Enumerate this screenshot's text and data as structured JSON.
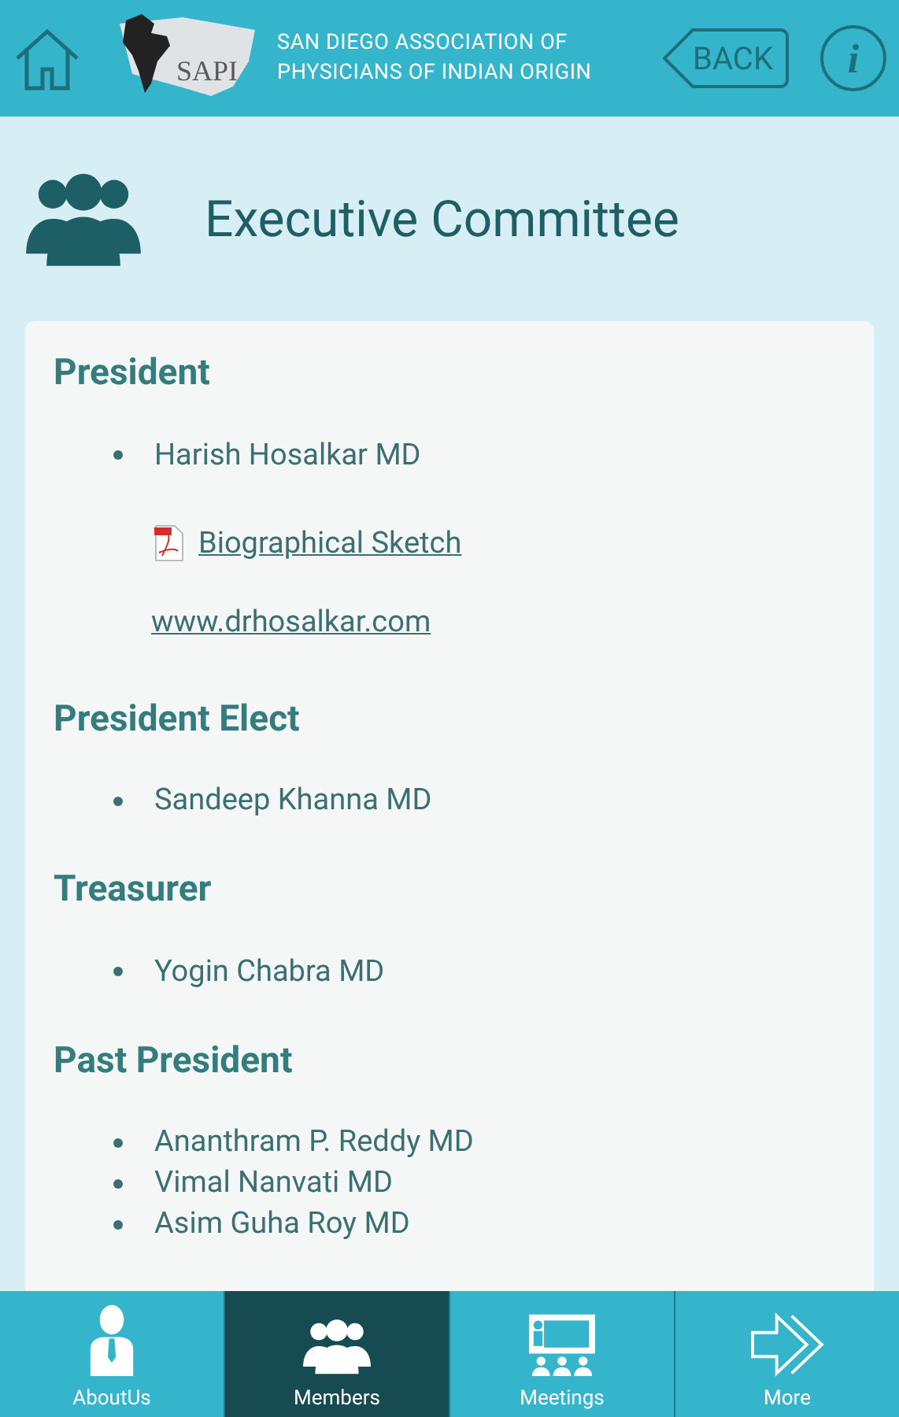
{
  "header": {
    "logo_text": "SAPI",
    "org_lines": [
      "SAN DIEGO ASSOCIATION OF",
      "PHYSICIANS OF INDIAN ORIGIN"
    ],
    "back": "BACK",
    "info": "i"
  },
  "page_title": "Executive Committee",
  "sections": [
    {
      "title": "President",
      "items": [
        {
          "kind": "bullet",
          "text": "Harish Hosalkar MD"
        },
        {
          "kind": "pdf",
          "text": "Biographical Sketch"
        },
        {
          "kind": "link",
          "text": "www.drhosalkar.com"
        }
      ]
    },
    {
      "title": "President Elect",
      "items": [
        {
          "kind": "bullet",
          "text": "Sandeep Khanna MD"
        }
      ]
    },
    {
      "title": "Treasurer",
      "items": [
        {
          "kind": "bullet",
          "text": "Yogin Chabra MD"
        }
      ]
    },
    {
      "title": "Past President",
      "items": [
        {
          "kind": "bullet",
          "text": "Ananthram P. Reddy MD"
        },
        {
          "kind": "bullet",
          "text": "Vimal Nanvati MD"
        },
        {
          "kind": "bullet",
          "text": "Asim Guha Roy MD"
        }
      ]
    }
  ],
  "nav": [
    {
      "label": "AboutUs",
      "kind": "person",
      "selected": false
    },
    {
      "label": "Members",
      "kind": "group",
      "selected": true
    },
    {
      "label": "Meetings",
      "kind": "meeting",
      "selected": false
    },
    {
      "label": "More",
      "kind": "arrows",
      "selected": false
    }
  ]
}
